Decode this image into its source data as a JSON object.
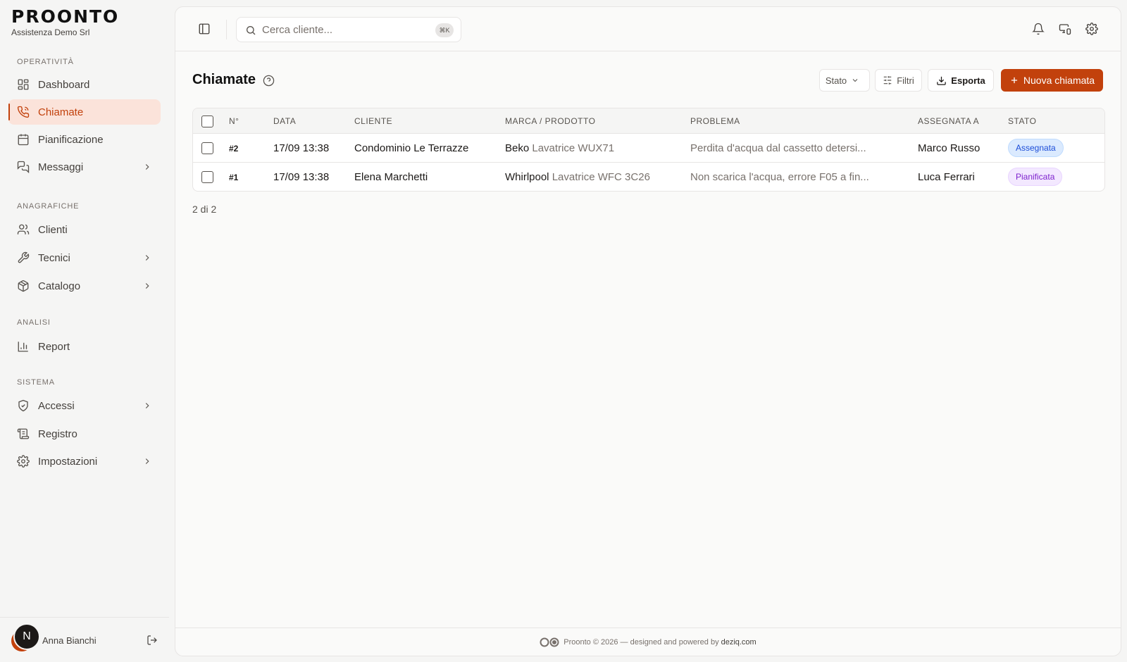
{
  "brand": {
    "logo": "PROONTO",
    "org": "Assistenza Demo Srl"
  },
  "sidebar": {
    "sections": [
      {
        "label": "OPERATIVITÀ"
      },
      {
        "label": "ANAGRAFICHE"
      },
      {
        "label": "ANALISI"
      },
      {
        "label": "SISTEMA"
      }
    ],
    "items": [
      {
        "label": "Dashboard",
        "icon": "dashboard-icon"
      },
      {
        "label": "Chiamate",
        "icon": "phone-icon",
        "active": true
      },
      {
        "label": "Pianificazione",
        "icon": "calendar-icon"
      },
      {
        "label": "Messaggi",
        "icon": "messages-icon",
        "expandable": true
      },
      {
        "label": "Clienti",
        "icon": "users-icon"
      },
      {
        "label": "Tecnici",
        "icon": "wrench-icon",
        "expandable": true
      },
      {
        "label": "Catalogo",
        "icon": "package-icon",
        "expandable": true
      },
      {
        "label": "Report",
        "icon": "bar-chart-icon"
      },
      {
        "label": "Accessi",
        "icon": "shield-icon",
        "expandable": true
      },
      {
        "label": "Registro",
        "icon": "log-icon"
      },
      {
        "label": "Impostazioni",
        "icon": "gear-icon",
        "expandable": true
      }
    ]
  },
  "user": {
    "initial": "N",
    "name": "Anna Bianchi"
  },
  "search": {
    "placeholder": "Cerca cliente...",
    "shortcut": "⌘K"
  },
  "page": {
    "title": "Chiamate",
    "filters": {
      "status": "Stato",
      "filters": "Filtri",
      "export": "Esporta",
      "new": "Nuova chiamata"
    },
    "columns": [
      "N°",
      "DATA",
      "CLIENTE",
      "MARCA / PRODOTTO",
      "PROBLEMA",
      "ASSEGNATA A",
      "STATO"
    ],
    "rows": [
      {
        "num": "#2",
        "date": "17/09 13:38",
        "client": "Condominio Le Terrazze",
        "brand": "Beko",
        "product": "Lavatrice WUX71",
        "problem": "Perdita d'acqua dal cassetto detersi...",
        "assignee": "Marco Russo",
        "status": "Assegnata"
      },
      {
        "num": "#1",
        "date": "17/09 13:38",
        "client": "Elena Marchetti",
        "brand": "Whirlpool",
        "product": "Lavatrice WFC 3C26",
        "problem": "Non scarica l'acqua, errore F05 a fin...",
        "assignee": "Luca Ferrari",
        "status": "Pianificata"
      }
    ],
    "count": "2 di 2"
  },
  "footer": {
    "text": "Proonto © 2026 — designed and powered by",
    "link": "deziq.com"
  },
  "colors": {
    "accent": "#c2410c",
    "assigned_bg": "#dbeafe",
    "assigned_fg": "#1d4ed8",
    "planned_bg": "#f3e8ff",
    "planned_fg": "#7e22ce"
  }
}
